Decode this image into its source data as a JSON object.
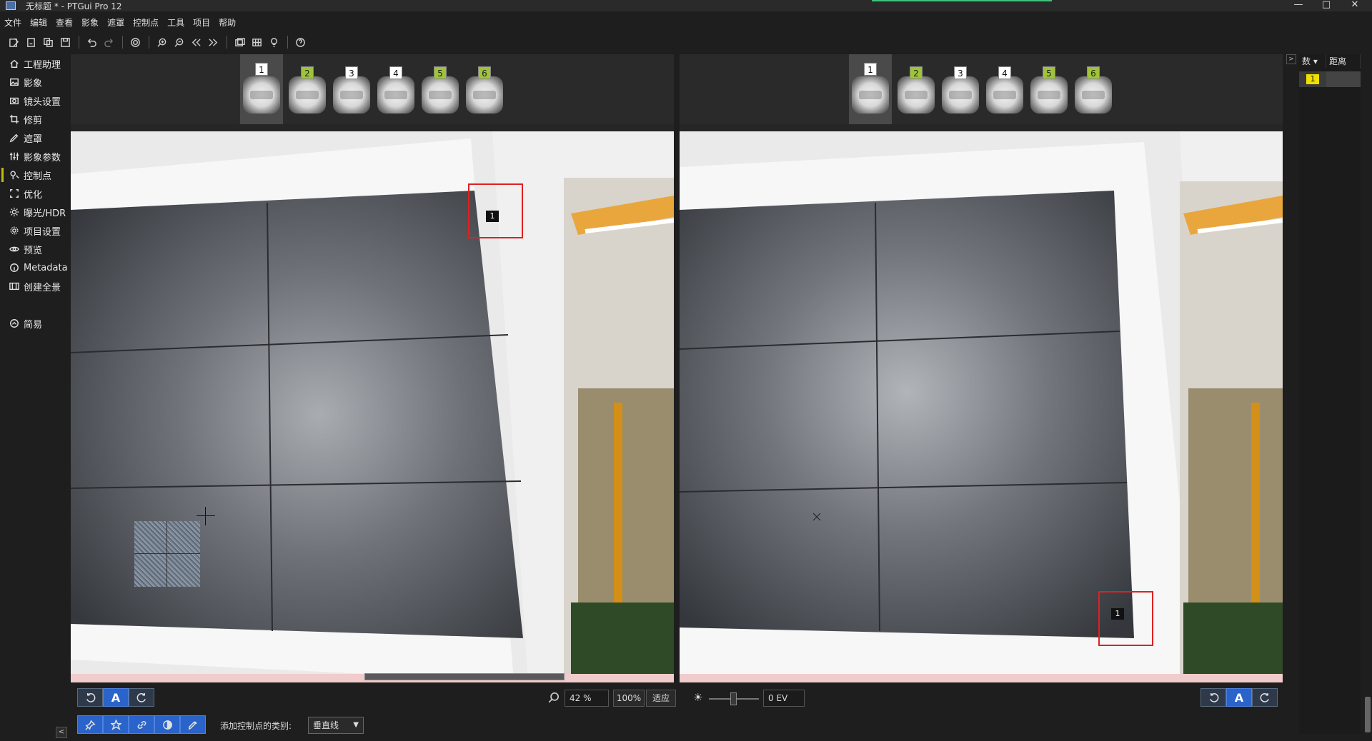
{
  "window": {
    "title": "无标题 * - PTGui Pro 12",
    "minimize": "—",
    "maximize": "□",
    "close": "✕"
  },
  "menu": [
    "文件",
    "编辑",
    "查看",
    "影象",
    "遮罩",
    "控制点",
    "工具",
    "项目",
    "帮助"
  ],
  "sidebar": [
    {
      "label": "工程助理",
      "icon": "home-icon"
    },
    {
      "label": "影象",
      "icon": "image-icon"
    },
    {
      "label": "镜头设置",
      "icon": "camera-icon"
    },
    {
      "label": "修剪",
      "icon": "crop-icon"
    },
    {
      "label": "遮罩",
      "icon": "pen-icon"
    },
    {
      "label": "影象参数",
      "icon": "sliders-icon"
    },
    {
      "label": "控制点",
      "icon": "pin-icon",
      "active": true
    },
    {
      "label": "优化",
      "icon": "optimize-icon"
    },
    {
      "label": "曝光/HDR",
      "icon": "sun-icon"
    },
    {
      "label": "项目设置",
      "icon": "gear-icon"
    },
    {
      "label": "预览",
      "icon": "eye-icon"
    },
    {
      "label": "Metadata",
      "icon": "info-icon"
    },
    {
      "label": "创建全景",
      "icon": "panorama-icon"
    }
  ],
  "sidebar_simple": {
    "label": "简易",
    "icon": "chevron-up-icon"
  },
  "thumbnails_left": [
    {
      "num": "1",
      "green": false
    },
    {
      "num": "2",
      "green": true
    },
    {
      "num": "3",
      "green": false
    },
    {
      "num": "4",
      "green": false
    },
    {
      "num": "5",
      "green": true
    },
    {
      "num": "6",
      "green": true
    }
  ],
  "thumbnails_right": [
    {
      "num": "1",
      "green": false
    },
    {
      "num": "2",
      "green": true
    },
    {
      "num": "3",
      "green": false
    },
    {
      "num": "4",
      "green": false
    },
    {
      "num": "5",
      "green": true
    },
    {
      "num": "6",
      "green": true
    }
  ],
  "control_point_label": "1",
  "zoom": {
    "value": "42 %",
    "btn_100": "100%",
    "btn_fit": "适应"
  },
  "exposure": {
    "value": "0 EV"
  },
  "add_cp": {
    "label": "添加控制点的类别:",
    "selected": "垂直线"
  },
  "cp_table": {
    "col1": "数 ▾",
    "col2": "距离",
    "row1": "1"
  },
  "colors": {
    "accent": "#2a63c9",
    "active_marker": "#c7b80d",
    "highlight": "#e02020",
    "cp_yellow": "#f0e000"
  }
}
